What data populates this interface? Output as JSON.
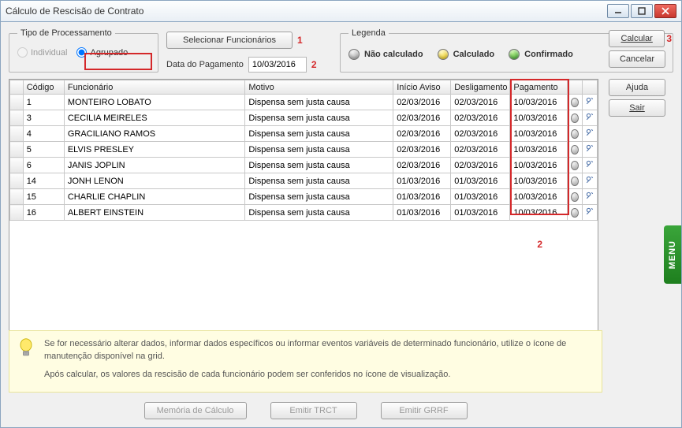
{
  "window": {
    "title": "Cálculo de Rescisão de Contrato"
  },
  "tipo_processamento": {
    "legend": "Tipo de Processamento",
    "individual_label": "Individual",
    "agrupado_label": "Agrupado"
  },
  "selecionar_btn": "Selecionar Funcionários",
  "annot": {
    "one": "1",
    "two": "2",
    "three": "3"
  },
  "data_pagamento": {
    "label": "Data do Pagamento",
    "value": "10/03/2016"
  },
  "legenda": {
    "legend": "Legenda",
    "nao_calculado": "Não calculado",
    "calculado": "Calculado",
    "confirmado": "Confirmado"
  },
  "side_btns": {
    "calcular": "Calcular",
    "cancelar": "Cancelar",
    "ajuda": "Ajuda",
    "sair": "Sair"
  },
  "grid": {
    "headers": {
      "codigo": "Código",
      "funcionario": "Funcionário",
      "motivo": "Motivo",
      "inicio_aviso": "Início Aviso",
      "desligamento": "Desligamento",
      "pagamento": "Pagamento"
    },
    "rows": [
      {
        "codigo": "1",
        "funcionario": "MONTEIRO LOBATO",
        "motivo": "Dispensa sem justa causa",
        "inicio": "02/03/2016",
        "deslig": "02/03/2016",
        "pag": "10/03/2016"
      },
      {
        "codigo": "3",
        "funcionario": "CECILIA MEIRELES",
        "motivo": "Dispensa sem justa causa",
        "inicio": "02/03/2016",
        "deslig": "02/03/2016",
        "pag": "10/03/2016"
      },
      {
        "codigo": "4",
        "funcionario": "GRACILIANO RAMOS",
        "motivo": "Dispensa sem justa causa",
        "inicio": "02/03/2016",
        "deslig": "02/03/2016",
        "pag": "10/03/2016"
      },
      {
        "codigo": "5",
        "funcionario": "ELVIS PRESLEY",
        "motivo": "Dispensa sem justa causa",
        "inicio": "02/03/2016",
        "deslig": "02/03/2016",
        "pag": "10/03/2016"
      },
      {
        "codigo": "6",
        "funcionario": "JANIS JOPLIN",
        "motivo": "Dispensa sem justa causa",
        "inicio": "02/03/2016",
        "deslig": "02/03/2016",
        "pag": "10/03/2016"
      },
      {
        "codigo": "14",
        "funcionario": "JONH LENON",
        "motivo": "Dispensa sem justa causa",
        "inicio": "01/03/2016",
        "deslig": "01/03/2016",
        "pag": "10/03/2016"
      },
      {
        "codigo": "15",
        "funcionario": "CHARLIE CHAPLIN",
        "motivo": "Dispensa sem justa causa",
        "inicio": "01/03/2016",
        "deslig": "01/03/2016",
        "pag": "10/03/2016"
      },
      {
        "codigo": "16",
        "funcionario": "ALBERT EINSTEIN",
        "motivo": "Dispensa sem justa causa",
        "inicio": "01/03/2016",
        "deslig": "01/03/2016",
        "pag": "10/03/2016"
      }
    ]
  },
  "hint": {
    "line1": "Se for necessário alterar dados, informar dados específicos ou informar eventos variáveis de determinado funcionário, utilize o ícone de manutenção disponível na grid.",
    "line2": "Após calcular, os valores da rescisão de cada funcionário podem ser conferidos no ícone de visualização."
  },
  "bottom_btns": {
    "memoria": "Memória de Cálculo",
    "trct": "Emitir TRCT",
    "grrf": "Emitir GRRF"
  },
  "menu_tab": "MENU"
}
